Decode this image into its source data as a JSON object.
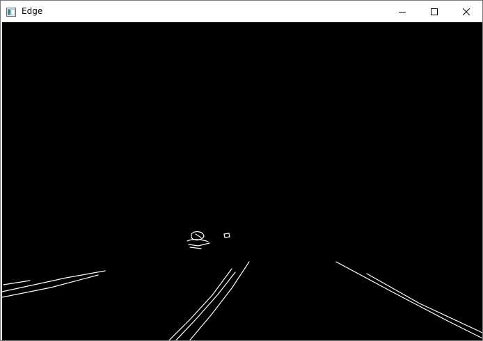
{
  "window": {
    "title": "Edge",
    "icon": "app-window-icon",
    "controls": {
      "minimize_icon": "minimize-icon",
      "maximize_icon": "maximize-icon",
      "close_icon": "close-icon"
    }
  },
  "colors": {
    "titlebar_bg": "#ffffff",
    "canvas_bg": "#000000",
    "edge_stroke": "#ffffff"
  }
}
